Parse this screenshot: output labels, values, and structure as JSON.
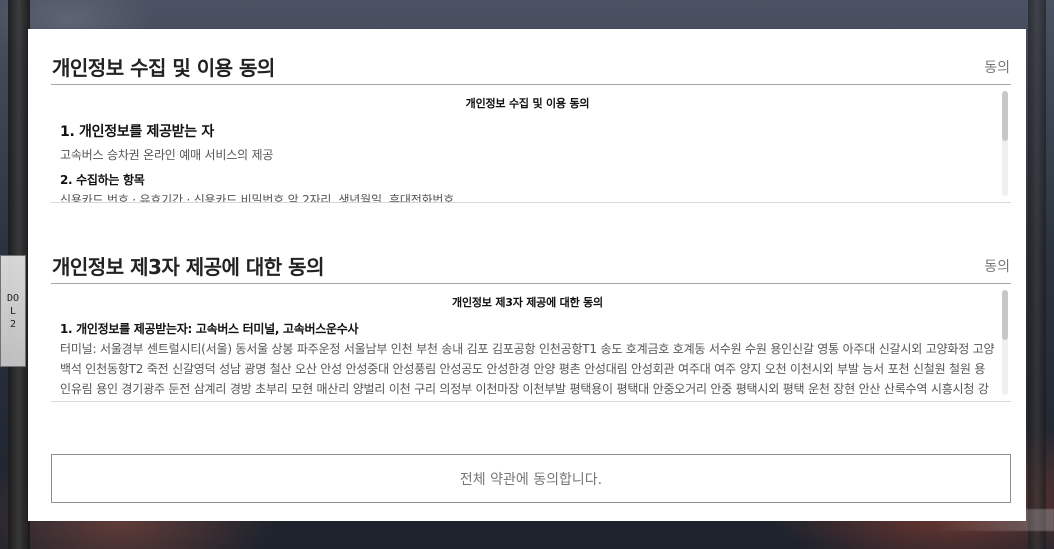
{
  "sections": [
    {
      "title": "개인정보 수집 및 이용 동의",
      "agree_label": "동의",
      "terms": {
        "heading": "개인정보 수집 및 이용 동의",
        "items": [
          {
            "title": "1. 개인정보를 제공받는 자",
            "body": "고속버스 승차권 온라인 예매 서비스의 제공"
          },
          {
            "title": "2. 수집하는 항목",
            "body": "신용카드 번호 · 유효기간 · 신용카드 비밀번호 앞 2자리, 생년월일, 휴대전화번호"
          }
        ]
      }
    },
    {
      "title": "개인정보 제3자 제공에 대한 동의",
      "agree_label": "동의",
      "terms": {
        "heading": "개인정보 제3자 제공에 대한 동의",
        "items": [
          {
            "title": "1. 개인정보를 제공받는자: 고속버스 터미널, 고속버스운수사",
            "body": "터미널: 서울경부 센트럴시티(서울) 동서울 상봉 파주운정 서울남부 인천 부천 송내 김포 김포공항 인천공항T1 송도 호계금호 호계동 서수원 수원 용인신갈 영통 아주대 신갈시외 고양화정 고양백석 인천동항T2 죽전 신갈영덕 성남 광명 철산 오산 안성 안성중대 안성풍림 안성공도 안성한경 안양 평촌 안성대림 안성회관 여주대 여주 양지 오천 이천시외 부발 능서 포천 신철원 철원 용인유림 용인 경기광주 둔전 삼계리 경방 초부리 모현 매산리 양벌리 이천 구리 의정부 이천마장 이천부발 평택용이 평택대 안중오거리 안중 평택시외 평택 운천 장현 안산 산록수역 시흥시청 강릉 동해 동해공항 강원대 삼척 속초 하계 원성 원주 횡성시외 홍천 남산 원주혁신 원주문막 춘천 청평 가평 강촌 화천 양양 양구 인제 대백 대전복합 대전시"
          }
        ]
      }
    }
  ],
  "all_agree_label": "전체 약관에 동의합니다.",
  "background_sign": [
    "DO",
    "L",
    "2"
  ]
}
